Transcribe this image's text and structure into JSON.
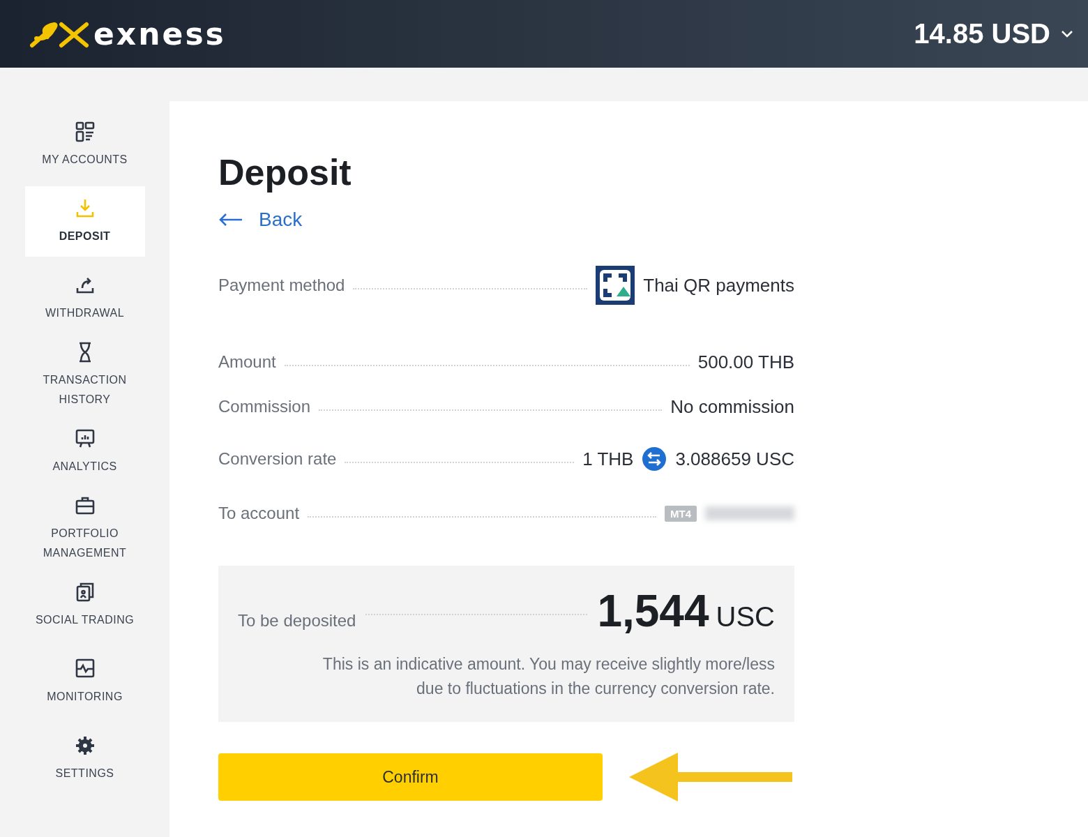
{
  "header": {
    "logo": "exness",
    "balance": "14.85 USD"
  },
  "sidebar": {
    "items": [
      {
        "label": "MY ACCOUNTS",
        "selected": false
      },
      {
        "label": "DEPOSIT",
        "selected": true
      },
      {
        "label": "WITHDRAWAL",
        "selected": false
      },
      {
        "label": "TRANSACTION HISTORY",
        "selected": false
      },
      {
        "label": "ANALYTICS",
        "selected": false
      },
      {
        "label": "PORTFOLIO MANAGEMENT",
        "selected": false
      },
      {
        "label": "SOCIAL TRADING",
        "selected": false
      },
      {
        "label": "MONITORING",
        "selected": false
      },
      {
        "label": "SETTINGS",
        "selected": false
      }
    ]
  },
  "page": {
    "title": "Deposit",
    "back": "Back"
  },
  "details": [
    {
      "kind": "method",
      "label": "Payment method",
      "value": "Thai QR payments"
    },
    {
      "kind": "text",
      "label": "Amount",
      "value": "500.00 THB"
    },
    {
      "kind": "text",
      "label": "Commission",
      "value": "No commission"
    },
    {
      "kind": "rate",
      "label": "Conversion rate",
      "from": "1 THB",
      "value": "3.088659 USC"
    },
    {
      "kind": "account",
      "label": "To account",
      "badge": "MT4"
    }
  ],
  "summary": {
    "label": "To be deposited",
    "amount": "1,544",
    "currency": "USC",
    "note": "This is an indicative amount. You may receive slightly more/less due to fluctuations in the currency conversion rate."
  },
  "confirm": "Confirm"
}
